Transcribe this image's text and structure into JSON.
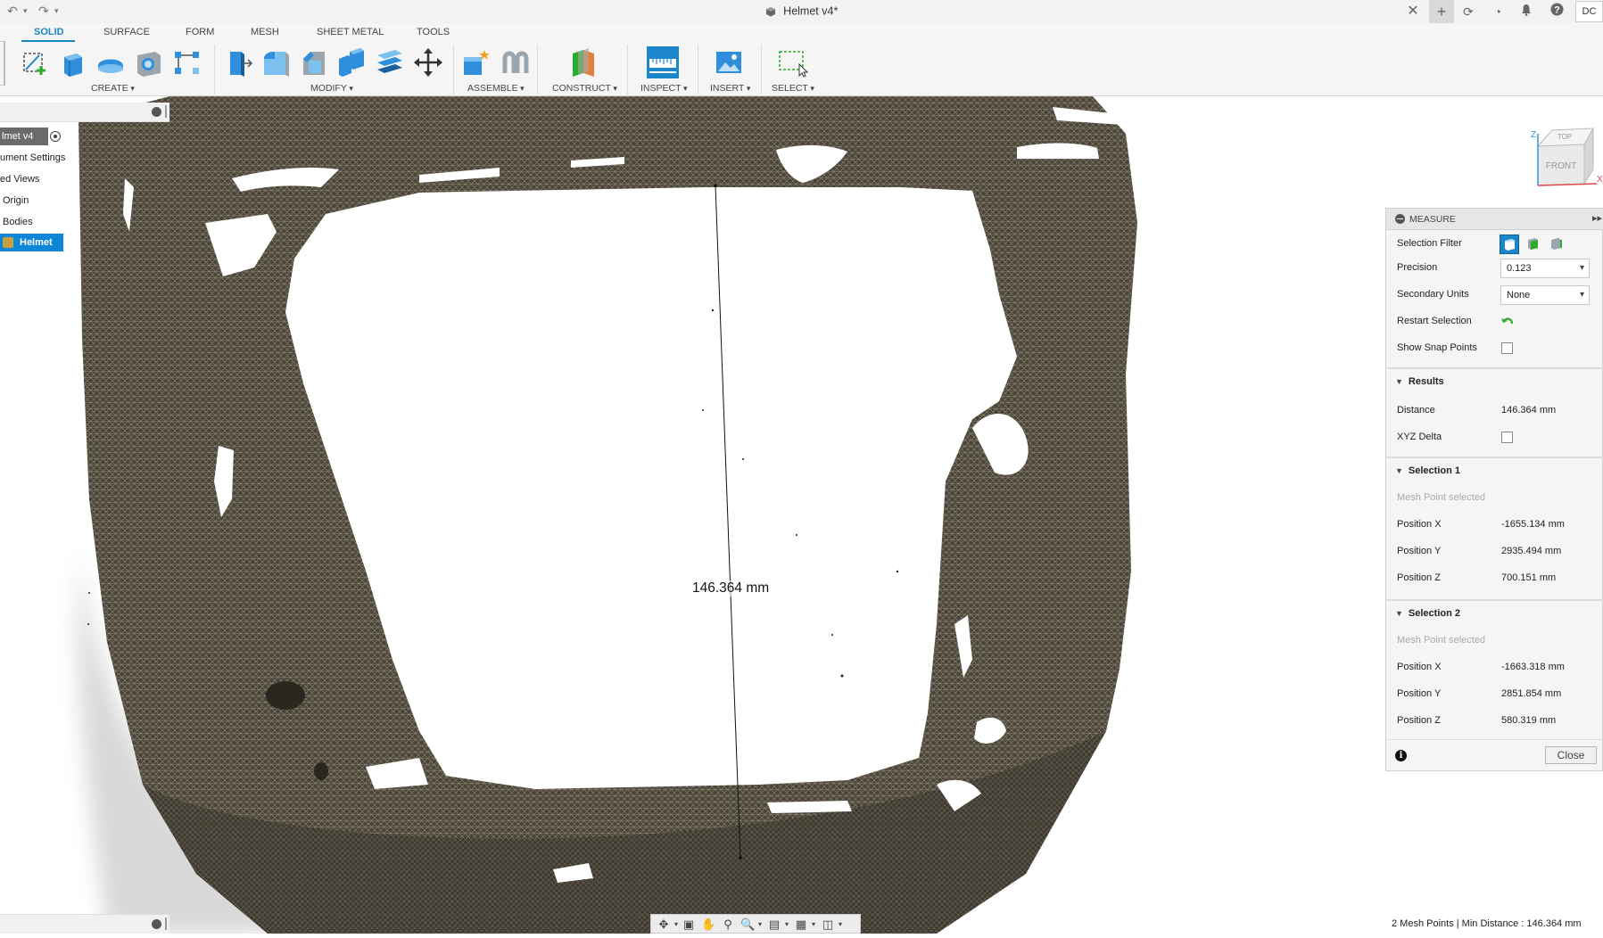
{
  "app": {
    "doc_title": "Helmet v4*",
    "avatar_initials": "DC"
  },
  "toolbar": {
    "tabs": [
      "SOLID",
      "SURFACE",
      "FORM",
      "MESH",
      "SHEET METAL",
      "TOOLS"
    ],
    "active_tab": "SOLID",
    "groups": {
      "create": "CREATE",
      "modify": "MODIFY",
      "assemble": "ASSEMBLE",
      "construct": "CONSTRUCT",
      "inspect": "INSPECT",
      "insert": "INSERT",
      "select": "SELECT"
    }
  },
  "browser": {
    "root": "lmet v4",
    "items": [
      "ument Settings",
      "ed Views",
      "Origin",
      "Bodies"
    ],
    "helmet": "Helmet"
  },
  "viewport": {
    "dimension_label": "146.364 mm",
    "viewcube": {
      "top": "TOP",
      "front": "FRONT",
      "z": "Z",
      "x": "X"
    }
  },
  "measure": {
    "title": "MEASURE",
    "selection_filter_label": "Selection Filter",
    "precision_label": "Precision",
    "precision_value": "0.123",
    "secondary_units_label": "Secondary Units",
    "secondary_units_value": "None",
    "restart_selection_label": "Restart Selection",
    "show_snap_points_label": "Show Snap Points",
    "results": {
      "title": "Results",
      "distance_label": "Distance",
      "distance_value": "146.364 mm",
      "xyz_delta_label": "XYZ Delta"
    },
    "selection1": {
      "title": "Selection 1",
      "status": "Mesh Point selected",
      "x_label": "Position X",
      "x_value": "-1655.134 mm",
      "y_label": "Position Y",
      "y_value": "2935.494 mm",
      "z_label": "Position Z",
      "z_value": "700.151 mm"
    },
    "selection2": {
      "title": "Selection 2",
      "status": "Mesh Point selected",
      "x_label": "Position X",
      "x_value": "-1663.318 mm",
      "y_label": "Position Y",
      "y_value": "2851.854 mm",
      "z_label": "Position Z",
      "z_value": "580.319 mm"
    },
    "close_label": "Close"
  },
  "status_bar": {
    "text": "2 Mesh Points | Min Distance : 146.364 mm"
  },
  "colors": {
    "accent": "#1b86c9",
    "selected_item": "#0d86d8",
    "mesh": "#4a4539"
  }
}
